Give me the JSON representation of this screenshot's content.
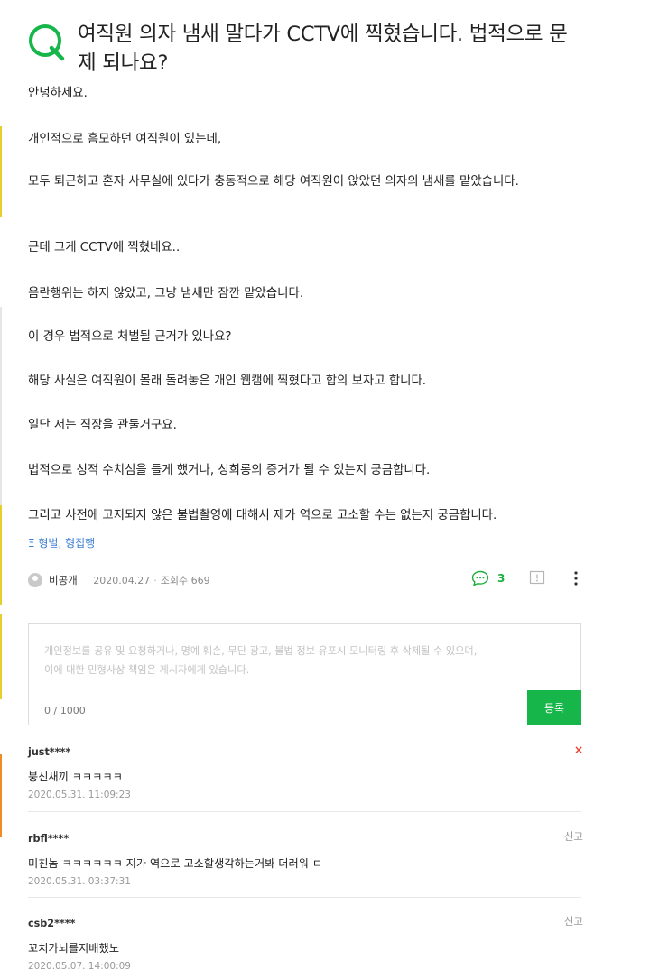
{
  "question": {
    "title_line1": "여직원 의자 냄새 말다가 CCTV에 찍혔습니다. 법적으로 문",
    "title_line2": "제 되나요?",
    "body": [
      "안녕하세요.",
      "개인적으로 흠모하던 여직원이 있는데,",
      "모두 퇴근하고 혼자 사무실에 있다가 충동적으로 해당 여직원이 앉았던 의자의 냄새를 맡았습니다.",
      "근데 그게 CCTV에 찍혔네요..",
      "음란행위는 하지 않았고, 그냥 냄새만 잠깐 맡았습니다.",
      "이 경우 법적으로 처벌될 근거가 있나요?",
      "해당 사실은 여직원이 몰래 돌려놓은 개인 웹캠에 찍혔다고 합의 보자고 합니다.",
      "일단 저는 직장을 관둘거구요.",
      "법적으로 성적 수치심을 들게 했거나, 성희롱의 증거가 될 수 있는지 궁금합니다.",
      "그리고 사전에 고지되지 않은 불법촬영에 대해서 제가 역으로 고소할 수는 없는지 궁금합니다."
    ],
    "category": "Ξ 형벌, 형집행",
    "author": "비공개",
    "date": "2020.04.27",
    "views": "조회수 669",
    "comment_count": "3"
  },
  "comment_form": {
    "placeholder_line1": "개인정보를 공유 및 요청하거나, 명예 훼손, 무단 광고, 불법 정보 유포시 모니터링 후 삭제될 수 있으며,",
    "placeholder_line2": "이에 대한 민형사상 책임은 게시자에게 있습니다.",
    "counter": "0 / 1000",
    "submit_label": "등록"
  },
  "comments": [
    {
      "user": "just****",
      "text": "붕신새끼 ㅋㅋㅋㅋㅋ",
      "date": "2020.05.31. 11:09:23",
      "side": "×"
    },
    {
      "user": "rbfl****",
      "text": "미친놈 ㅋㅋㅋㅋㅋㅋ 지가 역으로 고소할생각하는거봐 더러워 ㄷ",
      "date": "2020.05.31. 03:37:31",
      "side": "신고"
    },
    {
      "user": "csb2****",
      "text": "꼬치가뇌를지배했노",
      "date": "2020.05.07. 14:00:09",
      "side": "신고"
    }
  ],
  "colors": {
    "accent": "#16b64a",
    "link": "#3d7fd1",
    "delete": "#e8452f"
  },
  "icons": [
    "question-q-icon",
    "avatar-icon",
    "comment-bubble-icon",
    "report-icon",
    "more-vertical-icon"
  ]
}
